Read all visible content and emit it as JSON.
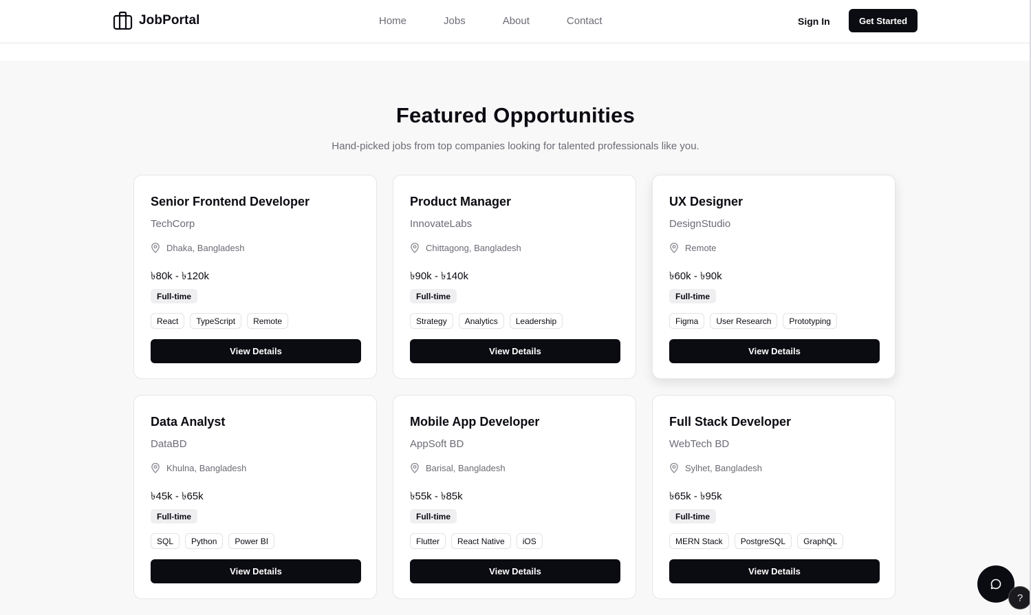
{
  "header": {
    "brand_name": "JobPortal",
    "brand_icon": "briefcase-icon",
    "nav": [
      "Home",
      "Jobs",
      "About",
      "Contact"
    ],
    "sign_in": "Sign In",
    "get_started": "Get Started"
  },
  "section": {
    "title": "Featured Opportunities",
    "subtitle": "Hand-picked jobs from top companies looking for talented professionals like you."
  },
  "jobs": [
    {
      "title": "Senior Frontend Developer",
      "company": "TechCorp",
      "location": "Dhaka, Bangladesh",
      "salary": "৳80k - ৳120k",
      "type": "Full-time",
      "tags": [
        "React",
        "TypeScript",
        "Remote"
      ],
      "button": "View Details"
    },
    {
      "title": "Product Manager",
      "company": "InnovateLabs",
      "location": "Chittagong, Bangladesh",
      "salary": "৳90k - ৳140k",
      "type": "Full-time",
      "tags": [
        "Strategy",
        "Analytics",
        "Leadership"
      ],
      "button": "View Details"
    },
    {
      "title": "UX Designer",
      "company": "DesignStudio",
      "location": "Remote",
      "salary": "৳60k - ৳90k",
      "type": "Full-time",
      "tags": [
        "Figma",
        "User Research",
        "Prototyping"
      ],
      "button": "View Details"
    },
    {
      "title": "Data Analyst",
      "company": "DataBD",
      "location": "Khulna, Bangladesh",
      "salary": "৳45k - ৳65k",
      "type": "Full-time",
      "tags": [
        "SQL",
        "Python",
        "Power BI"
      ],
      "button": "View Details"
    },
    {
      "title": "Mobile App Developer",
      "company": "AppSoft BD",
      "location": "Barisal, Bangladesh",
      "salary": "৳55k - ৳85k",
      "type": "Full-time",
      "tags": [
        "Flutter",
        "React Native",
        "iOS"
      ],
      "button": "View Details"
    },
    {
      "title": "Full Stack Developer",
      "company": "WebTech BD",
      "location": "Sylhet, Bangladesh",
      "salary": "৳65k - ৳95k",
      "type": "Full-time",
      "tags": [
        "MERN Stack",
        "PostgreSQL",
        "GraphQL"
      ],
      "button": "View Details"
    }
  ],
  "floating": {
    "chat_icon": "chat-bubble-icon",
    "help_label": "?"
  },
  "colors": {
    "primary": "#0b0b12",
    "muted_text": "#6b6b75",
    "section_bg": "#f8f8f8",
    "badge_bg": "#efeff2"
  }
}
